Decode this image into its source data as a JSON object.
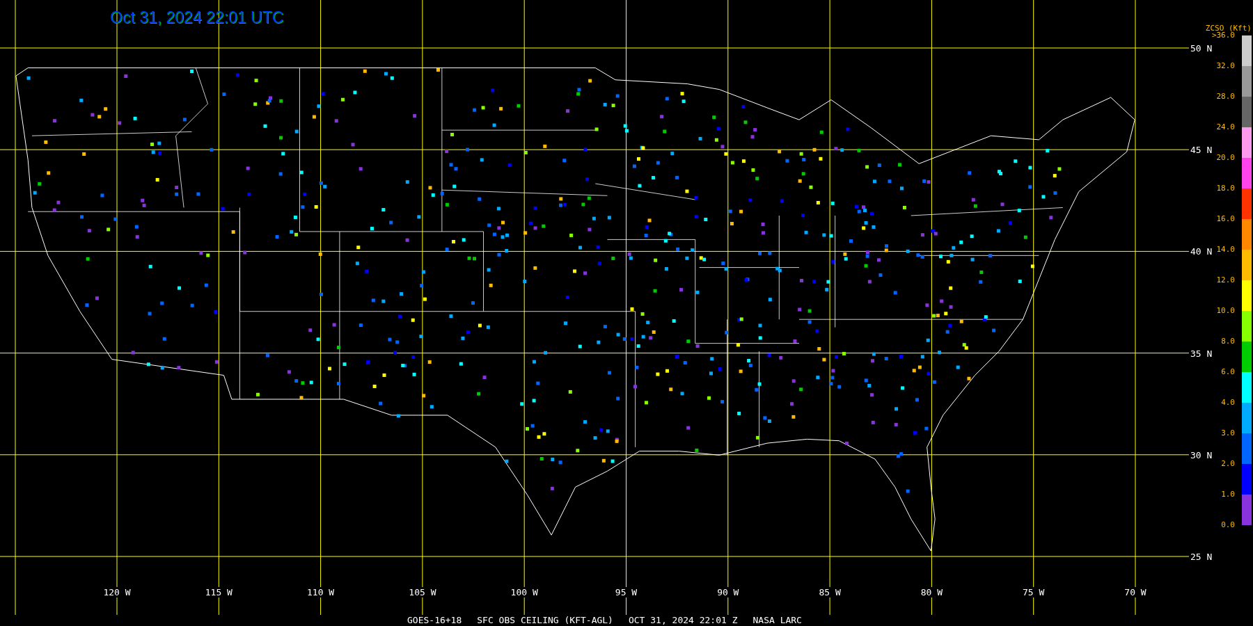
{
  "title": "Oct 31, 2024 22:01 UTC",
  "latitude_labels": [
    "50 N",
    "45 N",
    "40 N",
    "35 N",
    "30 N",
    "25 N"
  ],
  "longitude_labels": [
    "120 W",
    "115 W",
    "110 W",
    "105 W",
    "100 W",
    "95 W",
    "90 W",
    "85 W",
    "80 W",
    "75 W",
    "70 W"
  ],
  "legend": {
    "title": "ZCSO (Kft)",
    "bottom_label": "0.0",
    "bins": [
      {
        "label": ">36.0",
        "color": "#cccccc"
      },
      {
        "label": "32.0",
        "color": "#999999"
      },
      {
        "label": "28.0",
        "color": "#666666"
      },
      {
        "label": "24.0",
        "color": "#ff99ee"
      },
      {
        "label": "20.0",
        "color": "#ff44ee"
      },
      {
        "label": "18.0",
        "color": "#ff3300"
      },
      {
        "label": "16.0",
        "color": "#ff8800"
      },
      {
        "label": "14.0",
        "color": "#ffbb00"
      },
      {
        "label": "12.0",
        "color": "#ffff00"
      },
      {
        "label": "10.0",
        "color": "#88ff00"
      },
      {
        "label": "8.0",
        "color": "#00cc00"
      },
      {
        "label": "6.0",
        "color": "#00ffff"
      },
      {
        "label": "4.0",
        "color": "#00aaff"
      },
      {
        "label": "3.0",
        "color": "#0066ff"
      },
      {
        "label": "2.0",
        "color": "#0000ff"
      },
      {
        "label": "1.0",
        "color": "#8833dd"
      }
    ]
  },
  "caption": [
    "GOES-16+18",
    "SFC OBS CEILING (KFT-AGL)",
    "OCT 31, 2024 22:01 Z",
    "NASA LARC"
  ]
}
